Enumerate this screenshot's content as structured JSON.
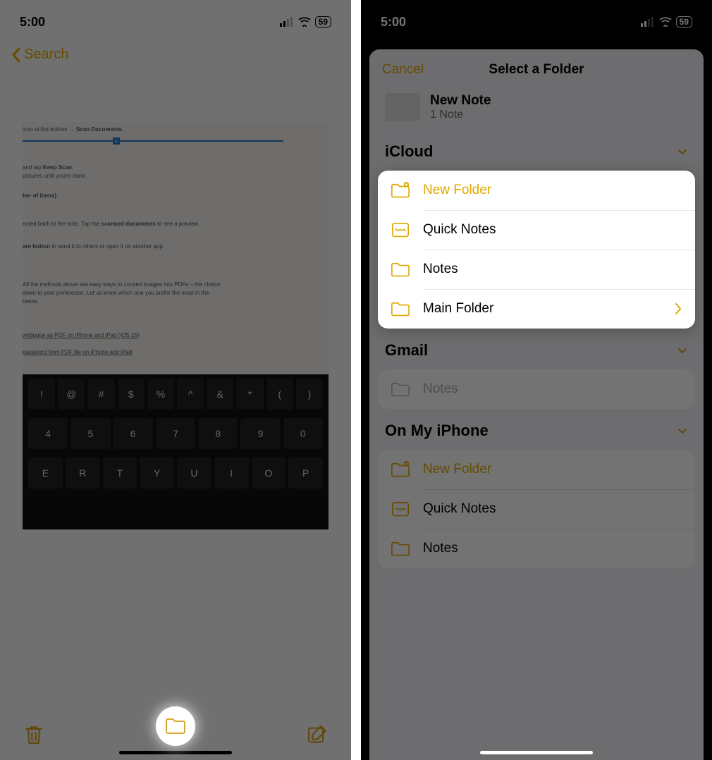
{
  "left": {
    "status": {
      "time": "5:00",
      "battery": "59"
    },
    "nav": {
      "back": "Search"
    },
    "note_lines": {
      "l1_a": "icon at the bottom → ",
      "l1_b": "Scan Documents",
      "l2_a": "and tap ",
      "l2_b": "Keep Scan",
      "l3": "pictures until you're done.",
      "l4": "ber of items)",
      "l5_a": "ected back to the note. Tap the ",
      "l5_b": "scanned documents",
      "l5_c": " to see a preview.",
      "l6_a": "are button",
      "l6_b": " to send it to others or open it on another app.",
      "l7": "All the methods above are easy ways to convert images into PDFs – the choice",
      "l8": "down to your preference. Let us know which one you prefer the most in the",
      "l9": "below.",
      "l10": "webpage as PDF on iPhone and iPad (iOS 15)",
      "l11": "password from PDF file on iPhone and iPad"
    },
    "keys_row1": [
      "!",
      "@",
      "#",
      "$",
      "%",
      "^",
      "&",
      "*",
      "(",
      ")"
    ],
    "keys_row2": [
      "4",
      "5",
      "6",
      "7",
      "8",
      "9",
      "0"
    ],
    "keys_row3": [
      "E",
      "R",
      "T",
      "Y",
      "U",
      "I",
      "O",
      "P"
    ]
  },
  "right": {
    "status": {
      "time": "5:00",
      "battery": "59"
    },
    "sheet": {
      "cancel": "Cancel",
      "title": "Select a Folder",
      "note": {
        "title": "New Note",
        "count": "1 Note"
      },
      "sections": [
        {
          "name": "iCloud",
          "highlight": true,
          "items": [
            {
              "label": "New Folder",
              "icon": "new-folder",
              "accent": true
            },
            {
              "label": "Quick Notes",
              "icon": "quick-notes"
            },
            {
              "label": "Notes",
              "icon": "folder"
            },
            {
              "label": "Main Folder",
              "icon": "folder",
              "chevron": true
            }
          ]
        },
        {
          "name": "Gmail",
          "highlight": false,
          "items": [
            {
              "label": "Notes",
              "icon": "folder",
              "muted": true
            }
          ]
        },
        {
          "name": "On My iPhone",
          "highlight": false,
          "items": [
            {
              "label": "New Folder",
              "icon": "new-folder",
              "accent": true
            },
            {
              "label": "Quick Notes",
              "icon": "quick-notes"
            },
            {
              "label": "Notes",
              "icon": "folder"
            }
          ]
        }
      ]
    }
  }
}
